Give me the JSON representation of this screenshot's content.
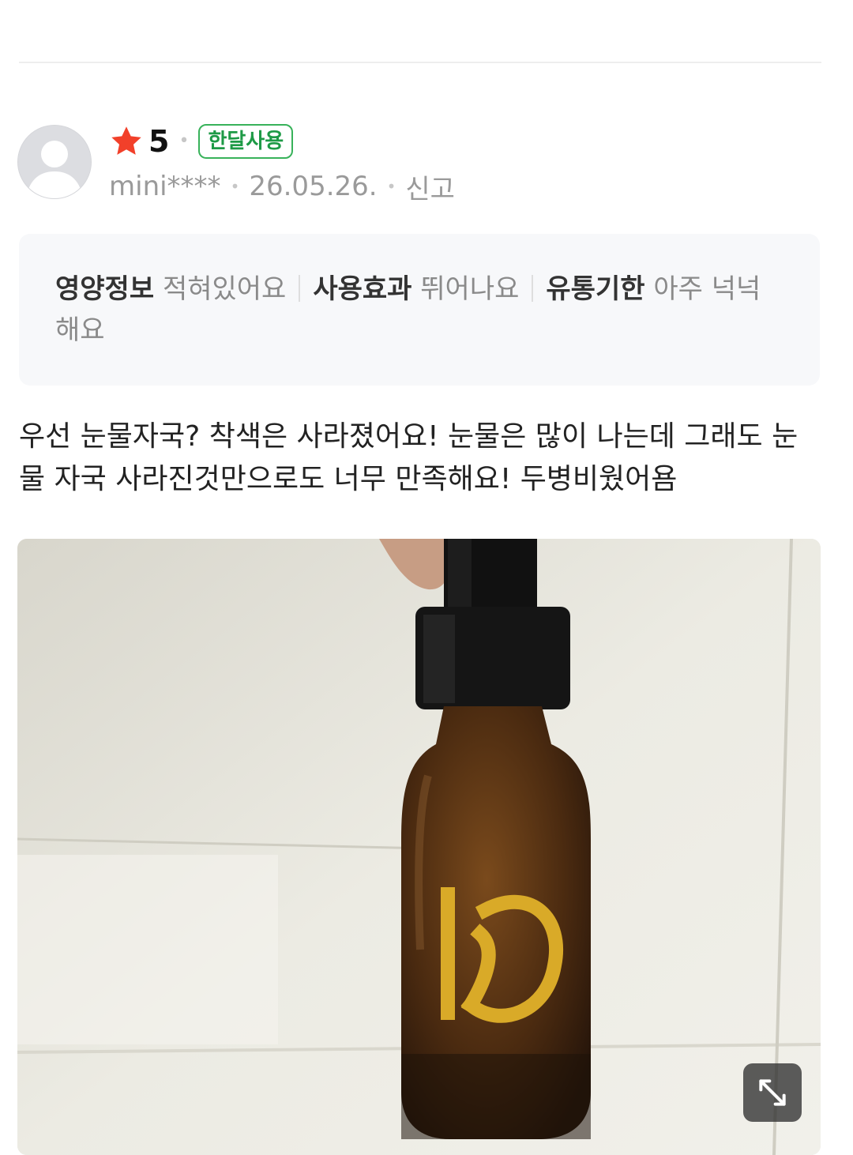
{
  "review": {
    "rating": "5",
    "badge": "한달사용",
    "username": "mini****",
    "date": "26.05.26.",
    "report_label": "신고",
    "attributes": [
      {
        "key": "영양정보",
        "value": "적혀있어요"
      },
      {
        "key": "사용효과",
        "value": "뛰어나요"
      },
      {
        "key": "유통기한",
        "value": "아주 넉넉해요"
      }
    ],
    "text": "우선 눈물자국? 착색은 사라졌어요! 눈물은 많이 나는데 그래도 눈물 자국 사라진것만으로도 너무 만족해요! 두병비웠어욤"
  },
  "icons": {
    "star": "star-icon",
    "avatar": "default-avatar-icon",
    "expand": "expand-icon"
  },
  "colors": {
    "star": "#f2402a",
    "badge_border": "#38b25a",
    "badge_text": "#1e9a46",
    "info_bg": "#f7f8fa"
  }
}
